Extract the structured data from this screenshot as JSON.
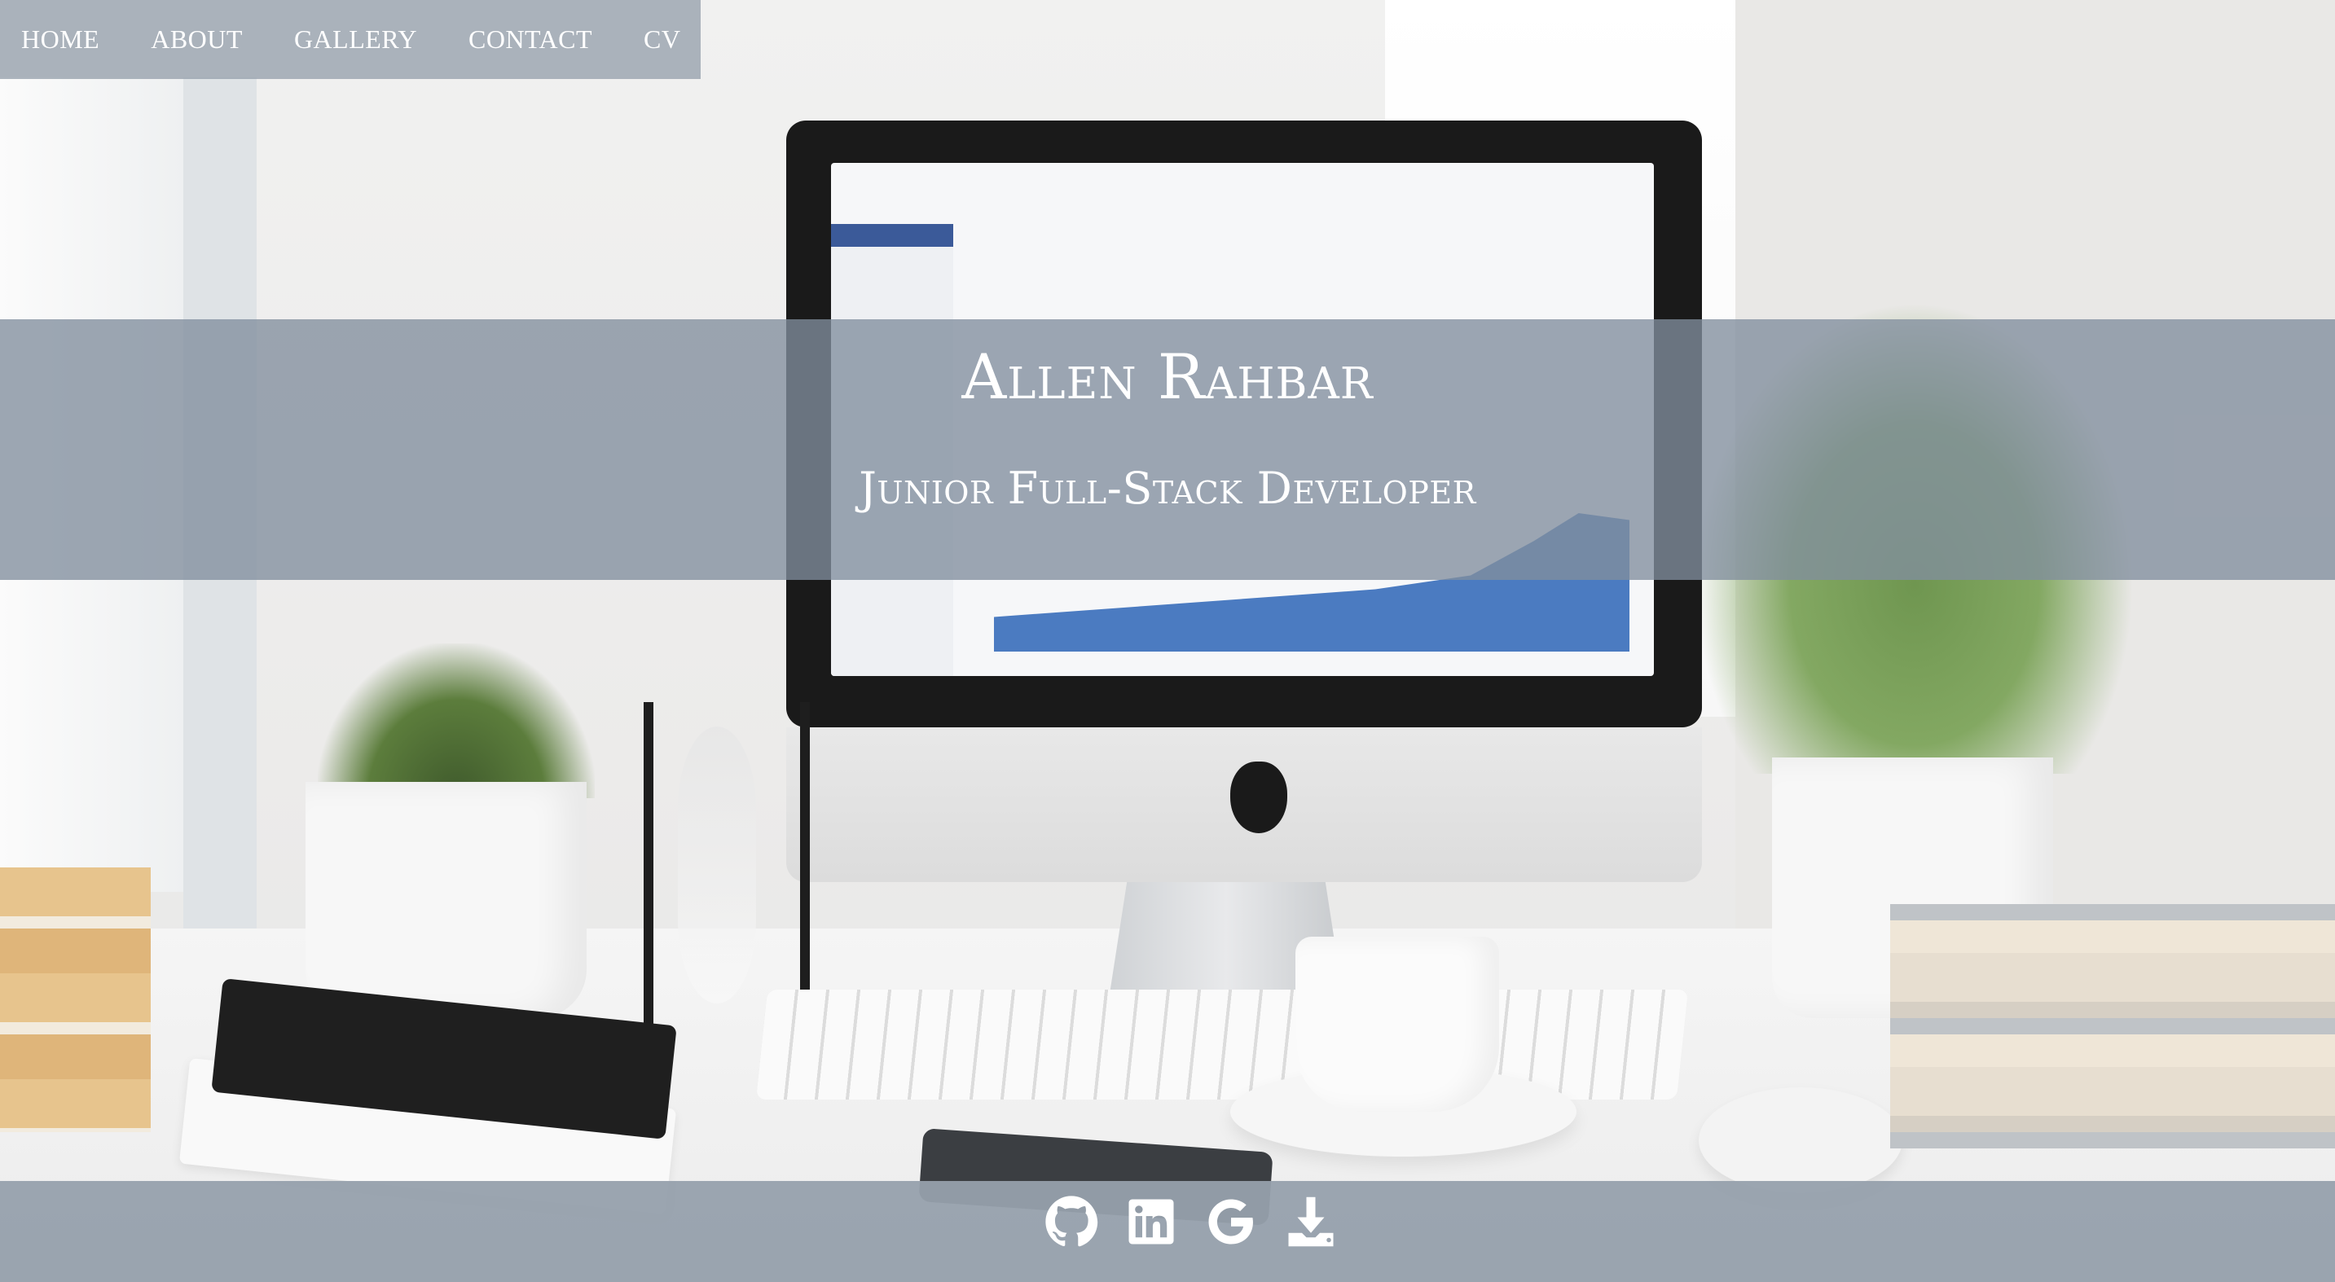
{
  "nav": {
    "items": [
      {
        "label": "HOME"
      },
      {
        "label": "ABOUT"
      },
      {
        "label": "GALLERY"
      },
      {
        "label": "CONTACT"
      },
      {
        "label": "CV"
      }
    ]
  },
  "hero": {
    "name": "Allen Rahbar",
    "role": "Junior Full-Stack Developer"
  },
  "footer": {
    "icons": [
      "github-icon",
      "linkedin-icon",
      "google-icon",
      "download-icon"
    ]
  },
  "colors": {
    "overlay": "#96a0ac",
    "text": "#ffffff"
  }
}
